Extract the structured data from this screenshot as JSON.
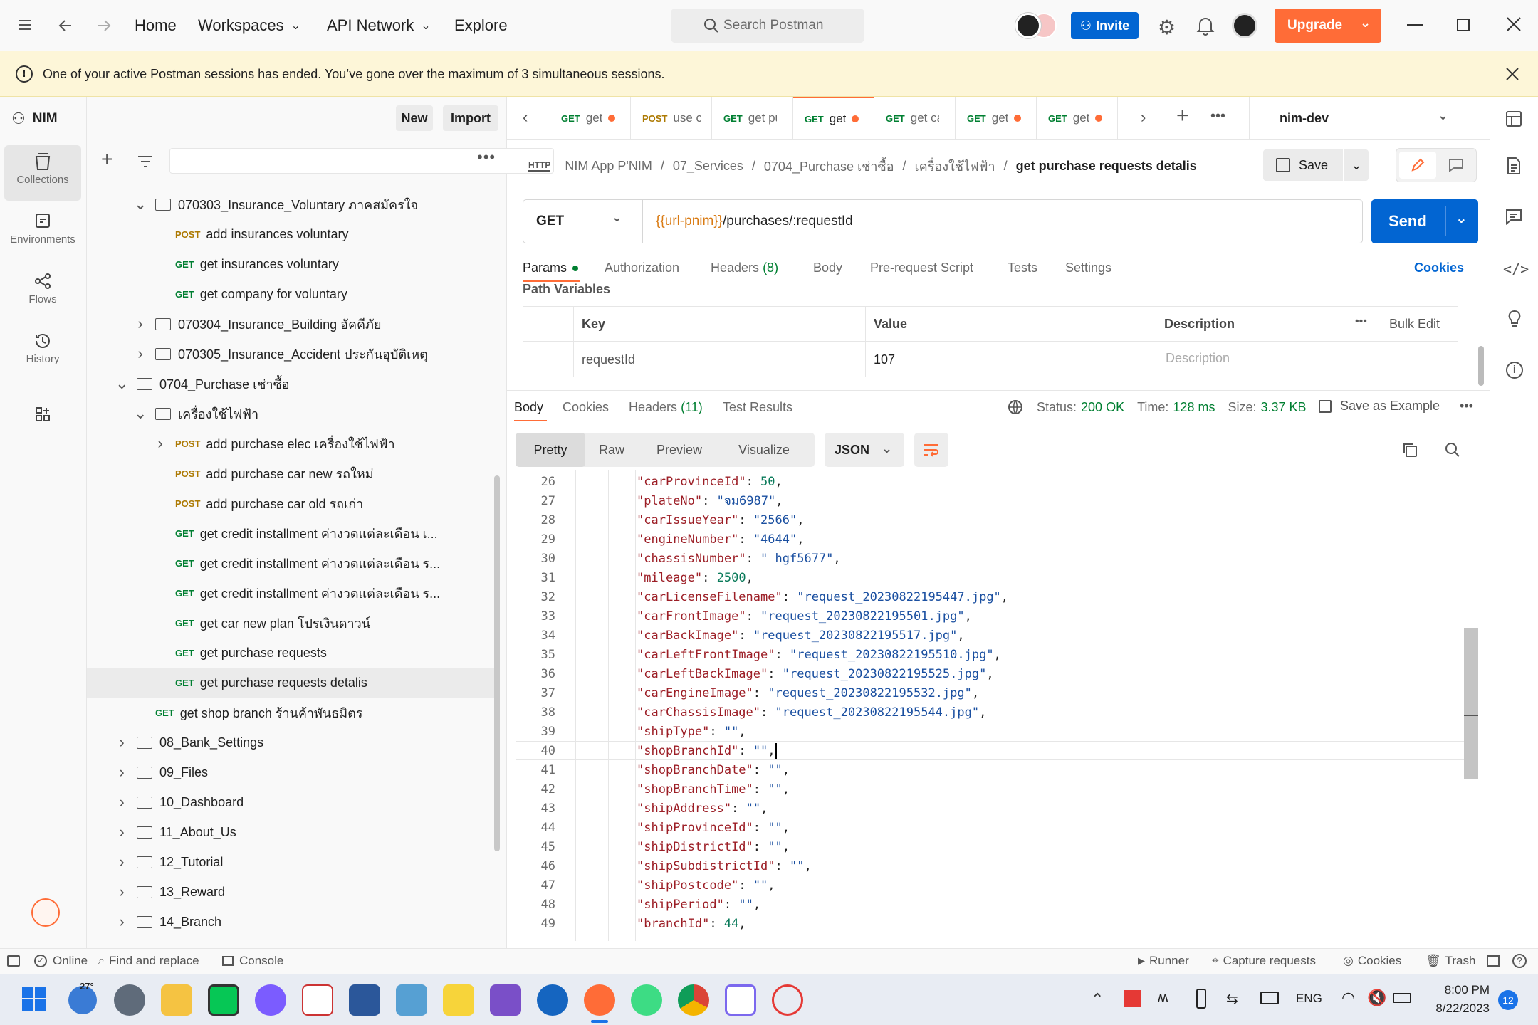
{
  "topbar": {
    "nav": {
      "home": "Home",
      "workspaces": "Workspaces",
      "api_network": "API Network",
      "explore": "Explore"
    },
    "search_placeholder": "Search Postman",
    "invite": "Invite",
    "upgrade": "Upgrade"
  },
  "banner": {
    "message": "One of your active Postman sessions has ended. You’ve gone over the maximum of 3 simultaneous sessions."
  },
  "workspace": {
    "name": "NIM",
    "new_label": "New",
    "import_label": "Import"
  },
  "rail": [
    {
      "label": "Collections",
      "icon": "collections-icon"
    },
    {
      "label": "Environments",
      "icon": "environments-icon"
    },
    {
      "label": "Flows",
      "icon": "flows-icon"
    },
    {
      "label": "History",
      "icon": "history-icon"
    }
  ],
  "tree": [
    {
      "kind": "folder",
      "depth": 2,
      "open": true,
      "label": "070303_Insurance_Voluntary ภาคสมัครใจ"
    },
    {
      "kind": "request",
      "depth": 3,
      "method": "POST",
      "label": "add insurances voluntary"
    },
    {
      "kind": "request",
      "depth": 3,
      "method": "GET",
      "label": "get insurances voluntary"
    },
    {
      "kind": "request",
      "depth": 3,
      "method": "GET",
      "label": "get company for voluntary"
    },
    {
      "kind": "folder",
      "depth": 2,
      "open": false,
      "label": "070304_Insurance_Building อัคคีภัย"
    },
    {
      "kind": "folder",
      "depth": 2,
      "open": false,
      "label": "070305_Insurance_Accident ประกันอุบัติเหตุ"
    },
    {
      "kind": "folder",
      "depth": 1,
      "open": true,
      "label": "0704_Purchase เช่าซื้อ"
    },
    {
      "kind": "folder",
      "depth": 2,
      "open": true,
      "label": "เครื่องใช้ไฟฟ้า"
    },
    {
      "kind": "request",
      "depth": 3,
      "method": "POST",
      "label": "add purchase elec เครื่องใช้ไฟฟ้า",
      "chevron": true
    },
    {
      "kind": "request",
      "depth": 3,
      "method": "POST",
      "label": "add purchase car new รถใหม่"
    },
    {
      "kind": "request",
      "depth": 3,
      "method": "POST",
      "label": "add purchase car old รถเก่า"
    },
    {
      "kind": "request",
      "depth": 3,
      "method": "GET",
      "label": "get credit installment ค่างวดแต่ละเดือน เ..."
    },
    {
      "kind": "request",
      "depth": 3,
      "method": "GET",
      "label": "get credit installment ค่างวดแต่ละเดือน ร..."
    },
    {
      "kind": "request",
      "depth": 3,
      "method": "GET",
      "label": "get credit installment ค่างวดแต่ละเดือน ร..."
    },
    {
      "kind": "request",
      "depth": 3,
      "method": "GET",
      "label": "get car new plan โปรเงินดาวน์"
    },
    {
      "kind": "request",
      "depth": 3,
      "method": "GET",
      "label": "get purchase requests"
    },
    {
      "kind": "request",
      "depth": 3,
      "method": "GET",
      "label": "get purchase requests detalis",
      "selected": true
    },
    {
      "kind": "request",
      "depth": 2,
      "method": "GET",
      "label": "get shop branch ร้านค้าพันธมิตร"
    },
    {
      "kind": "folder",
      "depth": 1,
      "open": false,
      "label": "08_Bank_Settings"
    },
    {
      "kind": "folder",
      "depth": 1,
      "open": false,
      "label": "09_Files"
    },
    {
      "kind": "folder",
      "depth": 1,
      "open": false,
      "label": "10_Dashboard"
    },
    {
      "kind": "folder",
      "depth": 1,
      "open": false,
      "label": "11_About_Us"
    },
    {
      "kind": "folder",
      "depth": 1,
      "open": false,
      "label": "12_Tutorial"
    },
    {
      "kind": "folder",
      "depth": 1,
      "open": false,
      "label": "13_Reward"
    },
    {
      "kind": "folder",
      "depth": 1,
      "open": false,
      "label": "14_Branch"
    }
  ],
  "tabs": [
    {
      "method": "GET",
      "label": "get ",
      "dot": true
    },
    {
      "method": "POST",
      "label": "use c",
      "dot": false
    },
    {
      "method": "GET",
      "label": "get pu",
      "dot": false
    },
    {
      "method": "GET",
      "label": "get",
      "dot": true,
      "active": true
    },
    {
      "method": "GET",
      "label": "get ca",
      "dot": false
    },
    {
      "method": "GET",
      "label": "get ",
      "dot": true
    },
    {
      "method": "GET",
      "label": "get ",
      "dot": true
    }
  ],
  "environment": "nim-dev",
  "breadcrumb": {
    "parts": [
      "NIM App P'NIM",
      "07_Services",
      "0704_Purchase เช่าซื้อ",
      "เครื่องใช้ไฟฟ้า"
    ],
    "current": "get purchase requests detalis",
    "sep": "/",
    "save": "Save"
  },
  "request": {
    "method": "GET",
    "url_var": "{{url-pnim}}",
    "url_path": "/purchases/:requestId",
    "send": "Send"
  },
  "request_tabs": {
    "params": "Params",
    "authorization": "Authorization",
    "headers": "Headers",
    "headers_count": "(8)",
    "body": "Body",
    "prerequest": "Pre-request Script",
    "tests": "Tests",
    "settings": "Settings",
    "cookies": "Cookies"
  },
  "path_variables": {
    "title": "Path Variables",
    "col_key": "Key",
    "col_value": "Value",
    "col_desc": "Description",
    "bulk_edit": "Bulk Edit",
    "row": {
      "key": "requestId",
      "value": "107",
      "desc_placeholder": "Description"
    }
  },
  "response": {
    "tabs": {
      "body": "Body",
      "cookies": "Cookies",
      "headers": "Headers",
      "headers_count": "(11)",
      "test_results": "Test Results"
    },
    "status_label": "Status:",
    "status": "200 OK",
    "time_label": "Time:",
    "time": "128 ms",
    "size_label": "Size:",
    "size": "3.37 KB",
    "save_example": "Save as Example",
    "views": {
      "pretty": "Pretty",
      "raw": "Raw",
      "preview": "Preview",
      "visualize": "Visualize"
    },
    "format": "JSON"
  },
  "code_lines": [
    {
      "n": "26",
      "k": "carProvinceId",
      "v": "50",
      "t": "num"
    },
    {
      "n": "27",
      "k": "plateNo",
      "v": "\"จม6987\"",
      "t": "str"
    },
    {
      "n": "28",
      "k": "carIssueYear",
      "v": "\"2566\"",
      "t": "str"
    },
    {
      "n": "29",
      "k": "engineNumber",
      "v": "\"4644\"",
      "t": "str"
    },
    {
      "n": "30",
      "k": "chassisNumber",
      "v": "\" hgf5677\"",
      "t": "str"
    },
    {
      "n": "31",
      "k": "mileage",
      "v": "2500",
      "t": "num"
    },
    {
      "n": "32",
      "k": "carLicenseFilename",
      "v": "\"request_20230822195447.jpg\"",
      "t": "str"
    },
    {
      "n": "33",
      "k": "carFrontImage",
      "v": "\"request_20230822195501.jpg\"",
      "t": "str"
    },
    {
      "n": "34",
      "k": "carBackImage",
      "v": "\"request_20230822195517.jpg\"",
      "t": "str"
    },
    {
      "n": "35",
      "k": "carLeftFrontImage",
      "v": "\"request_20230822195510.jpg\"",
      "t": "str"
    },
    {
      "n": "36",
      "k": "carLeftBackImage",
      "v": "\"request_20230822195525.jpg\"",
      "t": "str"
    },
    {
      "n": "37",
      "k": "carEngineImage",
      "v": "\"request_20230822195532.jpg\"",
      "t": "str"
    },
    {
      "n": "38",
      "k": "carChassisImage",
      "v": "\"request_20230822195544.jpg\"",
      "t": "str"
    },
    {
      "n": "39",
      "k": "shipType",
      "v": "\"\"",
      "t": "str"
    },
    {
      "n": "40",
      "k": "shopBranchId",
      "v": "\"\"",
      "t": "str",
      "cursor": true
    },
    {
      "n": "41",
      "k": "shopBranchDate",
      "v": "\"\"",
      "t": "str"
    },
    {
      "n": "42",
      "k": "shopBranchTime",
      "v": "\"\"",
      "t": "str"
    },
    {
      "n": "43",
      "k": "shipAddress",
      "v": "\"\"",
      "t": "str"
    },
    {
      "n": "44",
      "k": "shipProvinceId",
      "v": "\"\"",
      "t": "str"
    },
    {
      "n": "45",
      "k": "shipDistrictId",
      "v": "\"\"",
      "t": "str"
    },
    {
      "n": "46",
      "k": "shipSubdistrictId",
      "v": "\"\"",
      "t": "str"
    },
    {
      "n": "47",
      "k": "shipPostcode",
      "v": "\"\"",
      "t": "str"
    },
    {
      "n": "48",
      "k": "shipPeriod",
      "v": "\"\"",
      "t": "str"
    },
    {
      "n": "49",
      "k": "branchId",
      "v": "44",
      "t": "num"
    }
  ],
  "statusbar": {
    "online": "Online",
    "find_replace": "Find and replace",
    "console": "Console",
    "runner": "Runner",
    "capture": "Capture requests",
    "cookies": "Cookies",
    "trash": "Trash"
  },
  "taskbar": {
    "weather": "27°",
    "lang": "ENG",
    "time": "8:00 PM",
    "date": "8/22/2023",
    "notifications": "12"
  },
  "colors": {
    "accent": "#ff6c37",
    "send": "#0265d2",
    "get": "#007f31",
    "post": "#ad7a03",
    "status_ok": "#007f31"
  }
}
